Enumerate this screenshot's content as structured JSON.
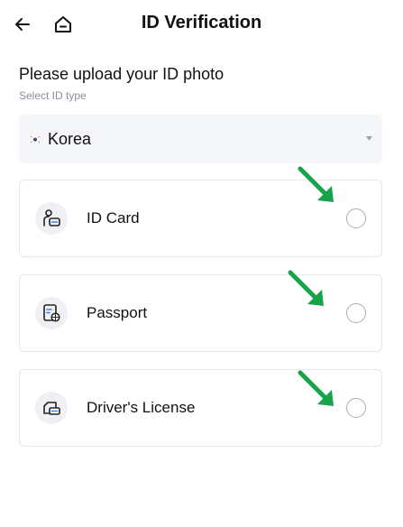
{
  "header": {
    "title": "ID Verification",
    "back_icon": "back-arrow-icon",
    "home_icon": "home-icon"
  },
  "main": {
    "heading": "Please upload your ID photo",
    "subheading": "Select ID type",
    "country_select": {
      "value": "Korea",
      "flag_icon": "korea-flag-icon",
      "caret_icon": "caret-down-icon"
    },
    "id_types": [
      {
        "label": "ID Card",
        "icon": "id-card-icon",
        "selected": false
      },
      {
        "label": "Passport",
        "icon": "passport-icon",
        "selected": false
      },
      {
        "label": "Driver's License",
        "icon": "drivers-license-icon",
        "selected": false
      }
    ]
  },
  "annotations": {
    "arrow_color": "#16a34a",
    "arrow_icon": "green-pointer-arrow-icon"
  },
  "colors": {
    "card_border": "#e4e7ec",
    "select_bg": "#f4f6fa",
    "muted_text": "#8a8f98"
  }
}
